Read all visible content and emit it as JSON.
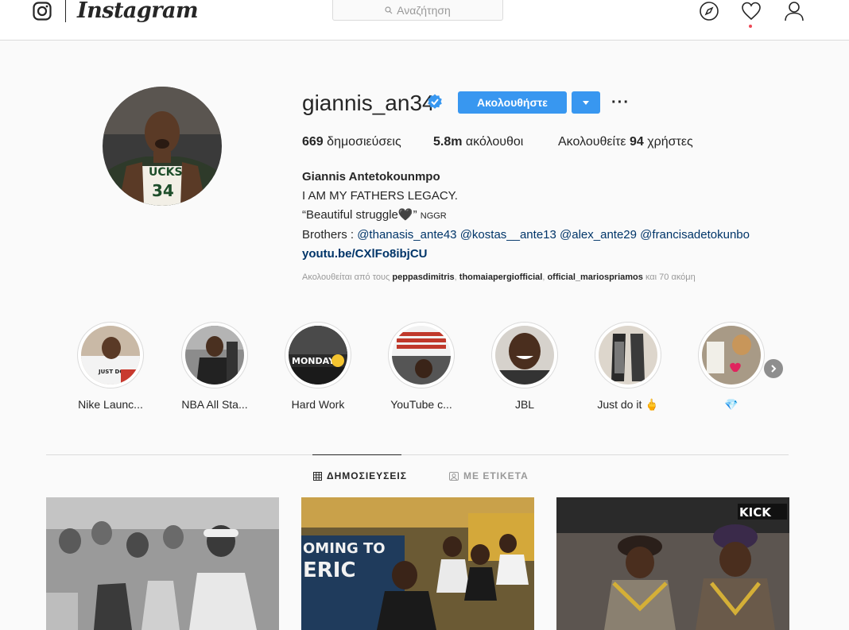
{
  "nav": {
    "brand": "Instagram",
    "search_placeholder": "Αναζήτηση",
    "icons": [
      "instagram-glyph-icon",
      "compass-icon",
      "heart-icon",
      "user-icon"
    ]
  },
  "profile": {
    "username": "giannis_an34",
    "verified": true,
    "follow_label": "Ακολουθήστε",
    "more_label": "···",
    "stats": {
      "posts_count": "669",
      "posts_label": "δημοσιεύσεις",
      "followers_count": "5.8m",
      "followers_label": "ακόλουθοι",
      "following_prefix": "Ακολουθείτε",
      "following_count": "94",
      "following_suffix": "χρήστες"
    },
    "bio": {
      "full_name": "Giannis Antetokounmpo",
      "line1": "I AM MY FATHERS LEGACY.",
      "line2_text": "“Beautiful struggle🖤”",
      "line2_small": "NGGR",
      "brothers_label": "Brothers :",
      "mentions": [
        "@thanasis_ante43",
        "@kostas__ante13",
        "@alex_ante29",
        "@francisadetokunbo"
      ],
      "link": "youtu.be/CXlFo8ibjCU"
    },
    "followed_by": {
      "prefix": "Ακολουθείται από τους",
      "users": [
        "peppasdimitris",
        "thomaiapergiofficial",
        "official_mariospriamos"
      ],
      "suffix": "και 70 ακόμη"
    }
  },
  "highlights": [
    {
      "label": "Nike Launc..."
    },
    {
      "label": "NBA All Sta..."
    },
    {
      "label": "Hard Work"
    },
    {
      "label": "YouTube c..."
    },
    {
      "label": "JBL"
    },
    {
      "label": "Just do it 🖕"
    },
    {
      "label": "💎"
    }
  ],
  "tabs": {
    "posts": "ΔΗΜΟΣΙΕΥΣΕΙΣ",
    "tagged": "ΜΕ ΕΤΙΚΕΤΑ"
  },
  "colors": {
    "accent": "#3897f0",
    "link": "#003569",
    "muted": "#999999",
    "border": "#dbdbdb"
  }
}
